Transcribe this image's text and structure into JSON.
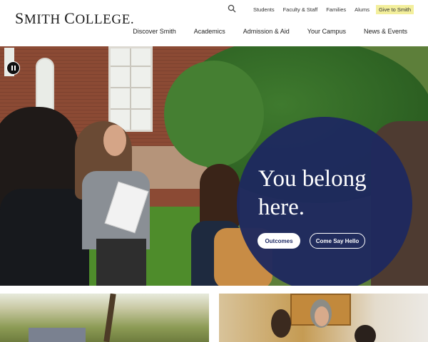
{
  "header": {
    "logo_text": "Smith College.",
    "utility": {
      "search_icon": "search-icon",
      "links": [
        "Students",
        "Faculty & Staff",
        "Families",
        "Alums"
      ],
      "give_label": "Give to Smith",
      "give_color": "#f3ef9c"
    },
    "nav": [
      "Discover Smith",
      "Academics",
      "Admission & Aid",
      "Your Campus",
      "News & Events"
    ]
  },
  "hero": {
    "tagline": "You belong here.",
    "pause_icon": "pause-icon",
    "circle_color": "#1e285f",
    "buttons": {
      "outcomes_label": "Outcomes",
      "hello_label": "Come Say Hello"
    }
  }
}
